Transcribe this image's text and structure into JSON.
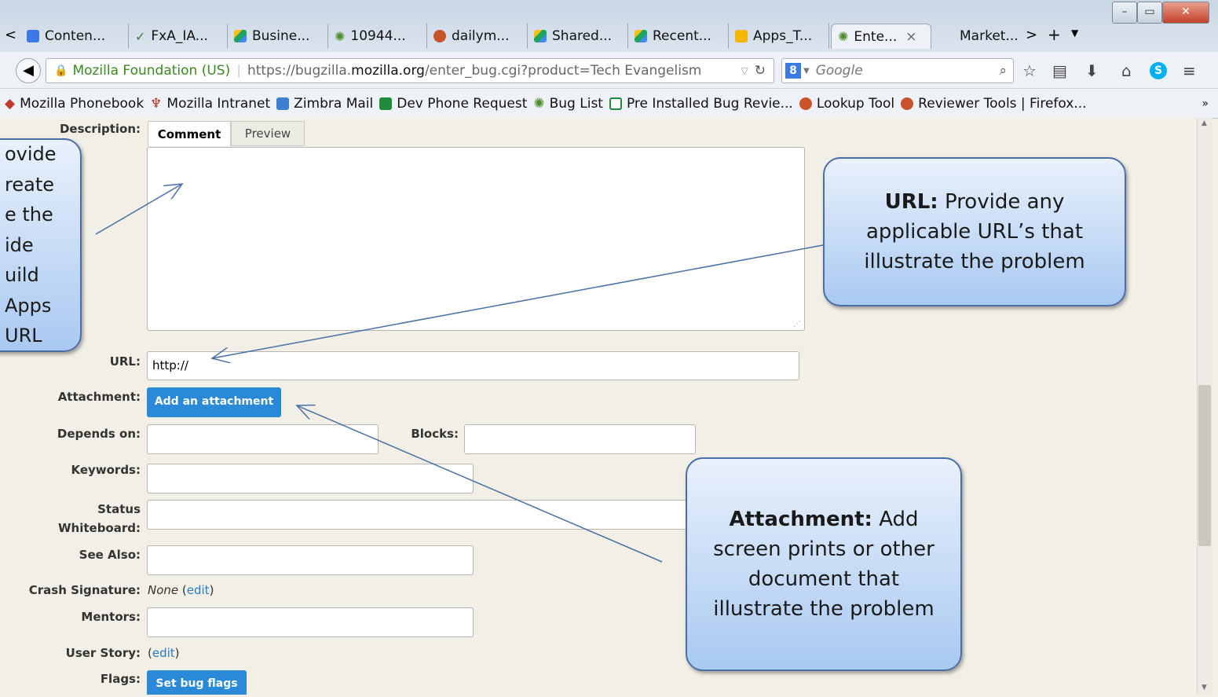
{
  "browser": {
    "tabs": [
      {
        "label": "Conten..."
      },
      {
        "label": "FxA_IA..."
      },
      {
        "label": "Busine..."
      },
      {
        "label": "10944..."
      },
      {
        "label": "dailym..."
      },
      {
        "label": "Shared..."
      },
      {
        "label": "Recent..."
      },
      {
        "label": "Apps_T..."
      },
      {
        "label": "Ente...",
        "close": "×"
      },
      {
        "label": "Market..."
      }
    ],
    "new_tab": "+",
    "site_identity": "Mozilla Foundation (US)",
    "url_prefix": "https://bugzilla.",
    "url_domain": "mozilla.org",
    "url_path": "/enter_bug.cgi?product=Tech Evangelism",
    "search_placeholder": "Google",
    "bookmarks": [
      {
        "label": "Mozilla Phonebook"
      },
      {
        "label": "Mozilla Intranet"
      },
      {
        "label": "Zimbra Mail"
      },
      {
        "label": "Dev Phone Request"
      },
      {
        "label": "Bug List"
      },
      {
        "label": "Pre Installed Bug Revie..."
      },
      {
        "label": "Lookup Tool"
      },
      {
        "label": "Reviewer Tools | Firefox..."
      }
    ],
    "bookmark_overflow": "»"
  },
  "form": {
    "description_label": "Description:",
    "tab_comment": "Comment",
    "tab_preview": "Preview",
    "url_label": "URL:",
    "url_value": "http://",
    "attachment_label": "Attachment:",
    "attachment_button": "Add an attachment",
    "depends_label": "Depends on:",
    "blocks_label": "Blocks:",
    "keywords_label": "Keywords:",
    "status_label_1": "Status",
    "status_label_2": "Whiteboard:",
    "see_also_label": "See Also:",
    "crash_label": "Crash Signature:",
    "crash_value": "None",
    "edit_link": "edit",
    "mentors_label": "Mentors:",
    "user_story_label": "User Story:",
    "flags_label": "Flags:",
    "flags_button": "Set bug flags"
  },
  "callouts": {
    "left_lines": [
      "ovide",
      "reate",
      "e the",
      "ide",
      "uild",
      "Apps",
      "URL"
    ],
    "url_bold": "URL:",
    "url_text": " Provide any applicable URL’s that illustrate the problem",
    "attach_bold": "Attachment:",
    "attach_text": " Add screen prints or other document that illustrate the problem"
  },
  "colors": {
    "accent": "#2a8ad8",
    "callout_border": "#4a6fa6",
    "link": "#2a7bc2"
  }
}
